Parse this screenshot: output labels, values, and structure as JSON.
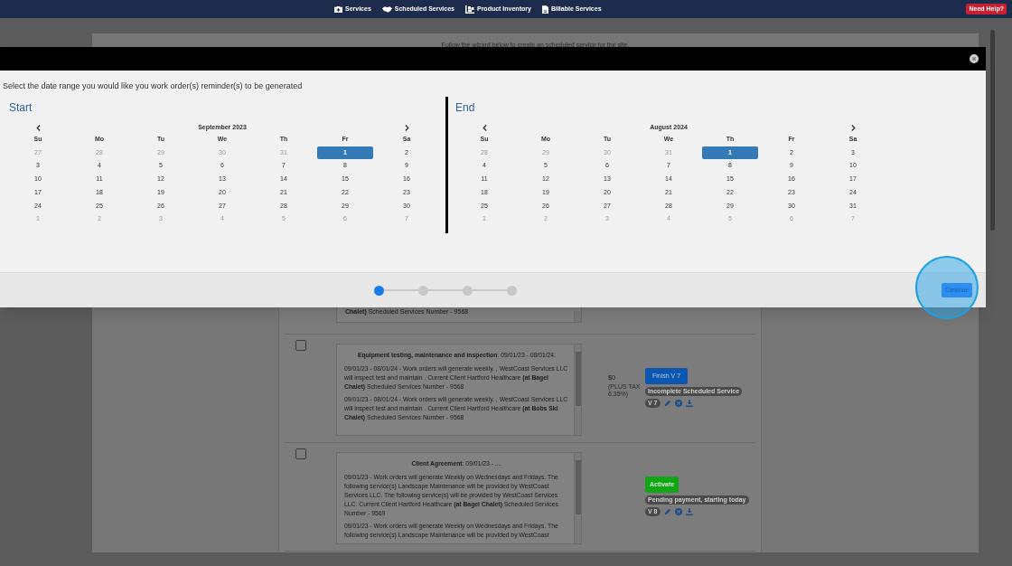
{
  "nav": {
    "items": [
      {
        "label": "Services"
      },
      {
        "label": "Scheduled Services"
      },
      {
        "label": "Product Inventory"
      },
      {
        "label": "Billable Services"
      }
    ],
    "help": "Need Help?"
  },
  "page": {
    "intro": "Follow the wizard below to create an scheduled service for the site.",
    "services": [
      {
        "kind": "cut",
        "text": "**Chalet)** Scheduled Services Number - 9568"
      },
      {
        "kind": "full",
        "checked": false,
        "title": "**Equipment testing, maintenance and inspection**: 09/01/23 - 08/01/24.",
        "paragraphs": [
          "09/01/23 - 08/01/24 - Work orders will generate weekly. , WestCoast Services LLC will inspect test and maintain . Current Client Hartford Healthcare **(at Bagel Chalet)** Scheduled Services Number - 9568",
          "09/01/23 - 08/01/24 - Work orders will generate weekly. , WestCoast Services LLC will inspect test and maintain . Current Client Hartford Healthcare **(at Bobs Ski Chalet)** Scheduled Services Number - 9568"
        ],
        "price": "$0",
        "tax": "(PLUS TAX 6.35%)",
        "action": {
          "label": "Finish V 7",
          "kind": "finish"
        },
        "status": "Incomplete Scheduled Service",
        "version": "V 7"
      },
      {
        "kind": "full",
        "checked": false,
        "title": "**Client Agreement**: 09/01/23 - ....",
        "paragraphs": [
          "09/01/23 - Work orders will generate Weekly on Wednesdays and Fridays. The following service(s) Landscape Maintenance will be provided by WestCoast Services LLC. The following service(s) will be provided by WestCoast Services LLC. Current Client Hartford Healthcare **(at Bagel Chalet)** Scheduled Services Number - 9569",
          "09/01/23 - Work orders will generate Weekly on Wednesdays and Fridays. The following service(s) Landscape Maintenance will be provided by WestCoast"
        ],
        "action": {
          "label": "Activate",
          "kind": "activate"
        },
        "status": "Pending payment, starting today",
        "version": "V 8"
      }
    ]
  },
  "modal": {
    "prompt": "Select the date range you would like you work order(s) reminder(s) to be generated",
    "calendars": [
      {
        "heading": "Start",
        "month": "September 2023",
        "weekdays": [
          "Su",
          "Mo",
          "Tu",
          "We",
          "Th",
          "Fr",
          "Sa"
        ],
        "weeks": [
          [
            {
              "day": "27",
              "muted": true,
              "selected": false
            },
            {
              "day": "28",
              "muted": true,
              "selected": false
            },
            {
              "day": "29",
              "muted": true,
              "selected": false
            },
            {
              "day": "30",
              "muted": true,
              "selected": false
            },
            {
              "day": "31",
              "muted": true,
              "selected": false
            },
            {
              "day": "1",
              "muted": false,
              "selected": true
            },
            {
              "day": "2",
              "muted": false,
              "selected": false
            }
          ],
          [
            {
              "day": "3",
              "muted": false,
              "selected": false
            },
            {
              "day": "4",
              "muted": false,
              "selected": false
            },
            {
              "day": "5",
              "muted": false,
              "selected": false
            },
            {
              "day": "6",
              "muted": false,
              "selected": false
            },
            {
              "day": "7",
              "muted": false,
              "selected": false
            },
            {
              "day": "8",
              "muted": false,
              "selected": false
            },
            {
              "day": "9",
              "muted": false,
              "selected": false
            }
          ],
          [
            {
              "day": "10",
              "muted": false,
              "selected": false
            },
            {
              "day": "11",
              "muted": false,
              "selected": false
            },
            {
              "day": "12",
              "muted": false,
              "selected": false
            },
            {
              "day": "13",
              "muted": false,
              "selected": false
            },
            {
              "day": "14",
              "muted": false,
              "selected": false
            },
            {
              "day": "15",
              "muted": false,
              "selected": false
            },
            {
              "day": "16",
              "muted": false,
              "selected": false
            }
          ],
          [
            {
              "day": "17",
              "muted": false,
              "selected": false
            },
            {
              "day": "18",
              "muted": false,
              "selected": false
            },
            {
              "day": "19",
              "muted": false,
              "selected": false
            },
            {
              "day": "20",
              "muted": false,
              "selected": false
            },
            {
              "day": "21",
              "muted": false,
              "selected": false
            },
            {
              "day": "22",
              "muted": false,
              "selected": false
            },
            {
              "day": "23",
              "muted": false,
              "selected": false
            }
          ],
          [
            {
              "day": "24",
              "muted": false,
              "selected": false
            },
            {
              "day": "25",
              "muted": false,
              "selected": false
            },
            {
              "day": "26",
              "muted": false,
              "selected": false
            },
            {
              "day": "27",
              "muted": false,
              "selected": false
            },
            {
              "day": "28",
              "muted": false,
              "selected": false
            },
            {
              "day": "29",
              "muted": false,
              "selected": false
            },
            {
              "day": "30",
              "muted": false,
              "selected": false
            }
          ],
          [
            {
              "day": "1",
              "muted": true,
              "selected": false
            },
            {
              "day": "2",
              "muted": true,
              "selected": false
            },
            {
              "day": "3",
              "muted": true,
              "selected": false
            },
            {
              "day": "4",
              "muted": true,
              "selected": false
            },
            {
              "day": "5",
              "muted": true,
              "selected": false
            },
            {
              "day": "6",
              "muted": true,
              "selected": false
            },
            {
              "day": "7",
              "muted": true,
              "selected": false
            }
          ]
        ]
      },
      {
        "heading": "End",
        "month": "August 2024",
        "weekdays": [
          "Su",
          "Mo",
          "Tu",
          "We",
          "Th",
          "Fr",
          "Sa"
        ],
        "weeks": [
          [
            {
              "day": "28",
              "muted": true,
              "selected": false
            },
            {
              "day": "29",
              "muted": true,
              "selected": false
            },
            {
              "day": "30",
              "muted": true,
              "selected": false
            },
            {
              "day": "31",
              "muted": true,
              "selected": false
            },
            {
              "day": "1",
              "muted": false,
              "selected": true
            },
            {
              "day": "2",
              "muted": false,
              "selected": false
            },
            {
              "day": "3",
              "muted": false,
              "selected": false
            }
          ],
          [
            {
              "day": "4",
              "muted": false,
              "selected": false
            },
            {
              "day": "5",
              "muted": false,
              "selected": false
            },
            {
              "day": "6",
              "muted": false,
              "selected": false
            },
            {
              "day": "7",
              "muted": false,
              "selected": false
            },
            {
              "day": "8",
              "muted": false,
              "selected": false
            },
            {
              "day": "9",
              "muted": false,
              "selected": false
            },
            {
              "day": "10",
              "muted": false,
              "selected": false
            }
          ],
          [
            {
              "day": "11",
              "muted": false,
              "selected": false
            },
            {
              "day": "12",
              "muted": false,
              "selected": false
            },
            {
              "day": "13",
              "muted": false,
              "selected": false
            },
            {
              "day": "14",
              "muted": false,
              "selected": false
            },
            {
              "day": "15",
              "muted": false,
              "selected": false
            },
            {
              "day": "16",
              "muted": false,
              "selected": false
            },
            {
              "day": "17",
              "muted": false,
              "selected": false
            }
          ],
          [
            {
              "day": "18",
              "muted": false,
              "selected": false
            },
            {
              "day": "19",
              "muted": false,
              "selected": false
            },
            {
              "day": "20",
              "muted": false,
              "selected": false
            },
            {
              "day": "21",
              "muted": false,
              "selected": false
            },
            {
              "day": "22",
              "muted": false,
              "selected": false
            },
            {
              "day": "23",
              "muted": false,
              "selected": false
            },
            {
              "day": "24",
              "muted": false,
              "selected": false
            }
          ],
          [
            {
              "day": "25",
              "muted": false,
              "selected": false
            },
            {
              "day": "26",
              "muted": false,
              "selected": false
            },
            {
              "day": "27",
              "muted": false,
              "selected": false
            },
            {
              "day": "28",
              "muted": false,
              "selected": false
            },
            {
              "day": "29",
              "muted": false,
              "selected": false
            },
            {
              "day": "30",
              "muted": false,
              "selected": false
            },
            {
              "day": "31",
              "muted": false,
              "selected": false
            }
          ],
          [
            {
              "day": "1",
              "muted": true,
              "selected": false
            },
            {
              "day": "2",
              "muted": true,
              "selected": false
            },
            {
              "day": "3",
              "muted": true,
              "selected": false
            },
            {
              "day": "4",
              "muted": true,
              "selected": false
            },
            {
              "day": "5",
              "muted": true,
              "selected": false
            },
            {
              "day": "6",
              "muted": true,
              "selected": false
            },
            {
              "day": "7",
              "muted": true,
              "selected": false
            }
          ]
        ]
      }
    ],
    "steps": [
      {
        "selected": true
      },
      {
        "selected": false
      },
      {
        "selected": false
      },
      {
        "selected": false
      }
    ],
    "continue": "Continue"
  }
}
